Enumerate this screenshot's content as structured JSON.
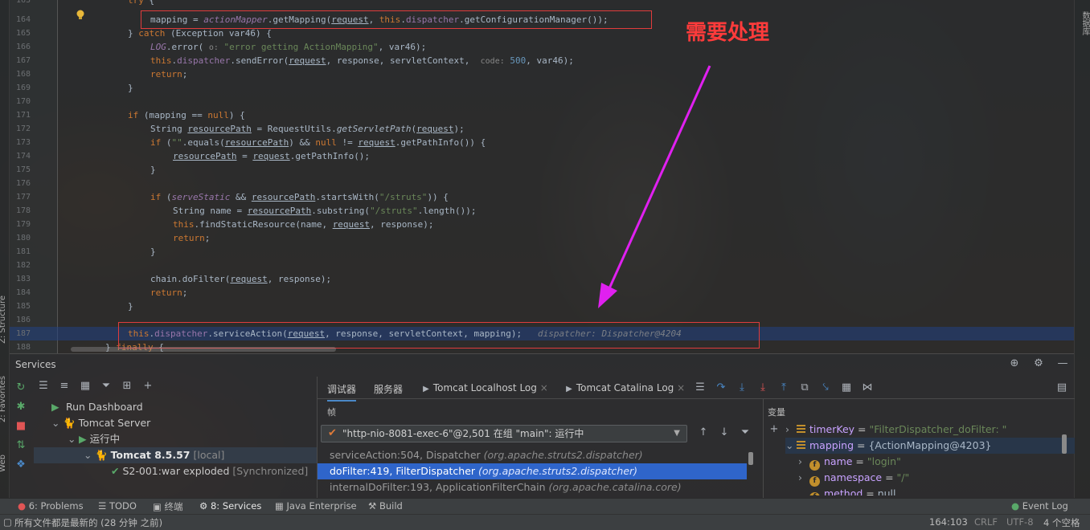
{
  "editor": {
    "annotation": "需要处理",
    "lines": [
      {
        "n": "163",
        "code": "try {"
      },
      {
        "n": "164",
        "code": "mapping = actionMapper.getMapping(request, this.dispatcher.getConfigurationManager());"
      },
      {
        "n": "165",
        "code": "} catch (Exception var46) {"
      },
      {
        "n": "166",
        "code": "LOG.error( o: \"error getting ActionMapping\", var46);"
      },
      {
        "n": "167",
        "code": "this.dispatcher.sendError(request, response, servletContext,  code: 500, var46);"
      },
      {
        "n": "168",
        "code": "return;"
      },
      {
        "n": "169",
        "code": "}"
      },
      {
        "n": "170",
        "code": ""
      },
      {
        "n": "171",
        "code": "if (mapping == null) {"
      },
      {
        "n": "172",
        "code": "String resourcePath = RequestUtils.getServletPath(request);"
      },
      {
        "n": "173",
        "code": "if (\"\".equals(resourcePath) && null != request.getPathInfo()) {"
      },
      {
        "n": "174",
        "code": "resourcePath = request.getPathInfo();"
      },
      {
        "n": "175",
        "code": "}"
      },
      {
        "n": "176",
        "code": ""
      },
      {
        "n": "177",
        "code": "if (serveStatic && resourcePath.startsWith(\"/struts\")) {"
      },
      {
        "n": "178",
        "code": "String name = resourcePath.substring(\"/struts\".length());"
      },
      {
        "n": "179",
        "code": "this.findStaticResource(name, request, response);"
      },
      {
        "n": "180",
        "code": "return;"
      },
      {
        "n": "181",
        "code": "}"
      },
      {
        "n": "182",
        "code": ""
      },
      {
        "n": "183",
        "code": "chain.doFilter(request, response);"
      },
      {
        "n": "184",
        "code": "return;"
      },
      {
        "n": "185",
        "code": "}"
      },
      {
        "n": "186",
        "code": ""
      },
      {
        "n": "187",
        "code": "this.dispatcher.serviceAction(request, response, servletContext, mapping);   dispatcher: Dispatcher@4204"
      },
      {
        "n": "188",
        "code": "} finally {"
      }
    ]
  },
  "left_strip": {
    "structure": "Z: Structure",
    "favorites": "2: Favorites",
    "web": "Web"
  },
  "right_strip": {
    "database": "数据库"
  },
  "services": {
    "title": "Services",
    "tree": {
      "run_dashboard": "Run Dashboard",
      "tomcat_server": "Tomcat Server",
      "running": "运行中",
      "tomcat_name": "Tomcat 8.5.57",
      "tomcat_suffix": "[local]",
      "artifact": "S2-001:war exploded",
      "artifact_status": "[Synchronized]"
    },
    "tabs": {
      "debugger": "调试器",
      "server": "服务器",
      "localhost_log": "Tomcat Localhost Log",
      "catalina_log": "Tomcat Catalina Log"
    },
    "frames_label": "帧",
    "vars_label": "变量",
    "thread": "\"http-nio-8081-exec-6\"@2,501 在组 \"main\": 运行中",
    "frames": [
      {
        "method": "serviceAction:504, Dispatcher",
        "pkg": "(org.apache.struts2.dispatcher)"
      },
      {
        "method": "doFilter:419, FilterDispatcher",
        "pkg": "(org.apache.struts2.dispatcher)"
      },
      {
        "method": "internalDoFilter:193, ApplicationFilterChain",
        "pkg": "(org.apache.catalina.core)"
      }
    ],
    "vars": [
      {
        "name": "timerKey",
        "eq": " = ",
        "value": "\"FilterDispatcher_doFilter: \""
      },
      {
        "name": "mapping",
        "eq": " = ",
        "value": "{ActionMapping@4203}"
      },
      {
        "name": "name",
        "eq": " = ",
        "value": "\"login\""
      },
      {
        "name": "namespace",
        "eq": " = ",
        "value": "\"/\""
      },
      {
        "name": "method",
        "eq": " = ",
        "value": "null"
      }
    ]
  },
  "bottom_tools": {
    "problems": "6: Problems",
    "todo": "TODO",
    "terminal": "终端",
    "services": "8: Services",
    "java_enterprise": "Java Enterprise",
    "build": "Build",
    "event_log": "Event Log"
  },
  "status": {
    "message": "所有文件都是最新的 (28 分钟 之前)",
    "position": "164:103",
    "line_sep": "CRLF",
    "encoding": "UTF-8",
    "indent": "4 个空格"
  },
  "colors": {
    "annotation": "#ff3b3b",
    "arrow": "#e020f0",
    "box": "#e03c3c",
    "selection": "#2f65ca"
  }
}
